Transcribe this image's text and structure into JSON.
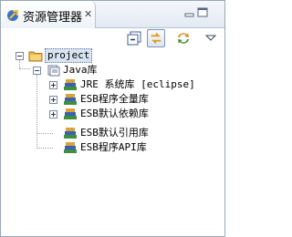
{
  "view": {
    "title": "资源管理器",
    "close_glyph": "✕",
    "icon": "explorer-icon"
  },
  "toolbar": {
    "collapse_icon": "collapse-all-icon",
    "link_icon": "link-with-editor-icon",
    "sync_icon": "sync-icon",
    "menu_icon": "view-menu-icon"
  },
  "tree": {
    "project": {
      "label": "project",
      "icon": "folder-project-icon"
    },
    "java_lib": {
      "label": "Java库",
      "icon": "library-icon"
    },
    "items": [
      {
        "label": "JRE 系统库 [eclipse]",
        "expandable": true,
        "icon": "library-icon"
      },
      {
        "label": "ESB程序全量库",
        "expandable": true,
        "icon": "library-icon"
      },
      {
        "label": "ESB默认依赖库",
        "expandable": true,
        "icon": "library-icon"
      },
      {
        "label": "ESB默认引用库",
        "expandable": false,
        "icon": "library-icon"
      },
      {
        "label": "ESB程序API库",
        "expandable": false,
        "icon": "library-icon"
      }
    ]
  },
  "colors": {
    "selection_bg": "#d9e4f2",
    "folder": "#e8b74a",
    "library_green": "#3f8f3f",
    "library_blue": "#3a62b4"
  }
}
